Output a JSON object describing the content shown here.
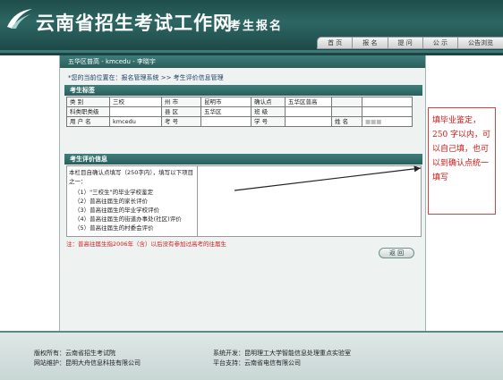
{
  "header": {
    "site_title": "云南省招生考试工作网",
    "subtitle": "考生报名",
    "nav": [
      "首 页",
      "报 名",
      "提 问",
      "公 示",
      "公告浏览"
    ]
  },
  "breadcrumb": "五华区普高 - kmcedu - 李晓宇",
  "location": "您的当前位置在：报名管理系统 >> 考生评价信息管理",
  "panel1_title": "考生标签",
  "info_table": {
    "row1": [
      "类    别",
      "三校",
      "州    市",
      "昆明市",
      "确认点",
      "五华区普高",
      "",
      ""
    ],
    "row2": [
      "科类职类级",
      "",
      "县    区",
      "五华区",
      "班    级",
      "",
      "",
      ""
    ],
    "row3": [
      "用 户 名",
      "kmcedu",
      "考    号",
      "",
      "学    号",
      "",
      "姓    名",
      "■■■"
    ]
  },
  "panel2_title": "考生评价信息",
  "eval": {
    "intro": "本栏目自确认点填写（250字内），填写以下项目之一：",
    "items": [
      "（1）\"三校生\"的毕业学校鉴定",
      "（2）普高往届生的家长评价",
      "（3）普高往届生的毕业学校评价",
      "（4）普高往届生的街道办事处(社区)评价",
      "（5）普高往届生的村委会评价"
    ],
    "textarea_value": ""
  },
  "note": "注：普高往届生指2006年（含）以后没有参加过高考的往届生",
  "back_button": "返  回",
  "callout_text": "填毕业鉴定，250 字以内，可以自己填，也可以到确认点统一填写",
  "footer": {
    "copyright_label": "版权所有：",
    "copyright_value": "云南省招生考试院",
    "maintain_label": "网站维护：",
    "maintain_value": "昆明大舟信息科技有限公司",
    "dev_label": "系统开发：",
    "dev_value": "昆明理工大学智能信息处理重点实验室",
    "support_label": "平台支持：",
    "support_value": "云南省电信有限公司"
  },
  "colors": {
    "header_bg": "#2d6663",
    "accent_red": "#c41818",
    "panel_bar": "#2a5f5c"
  }
}
